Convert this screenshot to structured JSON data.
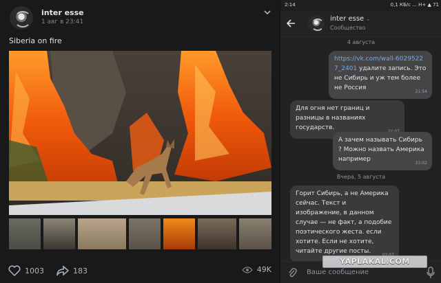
{
  "post": {
    "author": "inter esse",
    "date": "1 авг в 23:41",
    "text": "Siberia on fire",
    "likes": "1003",
    "shares": "183",
    "views": "49K"
  },
  "chat": {
    "status_time": "2:14",
    "status_right": "0,1 КБ/с ... H+ ▲ 71",
    "name": "inter esse",
    "subtitle": "Сообщество",
    "date1": "4 августа",
    "date2": "Вчера, 5 августа",
    "messages": [
      {
        "link": "https://vk.com/wall-60295227_2401",
        "text": " удалите запись. Это не Сибирь и уж тем более не Россия",
        "time": "21:54",
        "out": true
      },
      {
        "text": "Для огня нет границ и разницы в названиях государств.",
        "time": "22:07",
        "out": false
      },
      {
        "text": "А зачем называть Сибирь ? Можно назвать Америка например",
        "time": "23:02",
        "out": true
      },
      {
        "text": "Горит Сибирь, а не Америка сейчас. Текст и изображение, в данном случае — не факт, а подобие поэтического жеста. если хотите. Если не хотите, читайте другие посты.",
        "time": "02:07",
        "out": false
      }
    ],
    "input_placeholder": "Ваше сообщение"
  },
  "watermark": "YAPLAKAL.COM",
  "colors": {
    "link": "#71aaeb",
    "fire": "#f06a0e",
    "bg": "#19191a"
  }
}
